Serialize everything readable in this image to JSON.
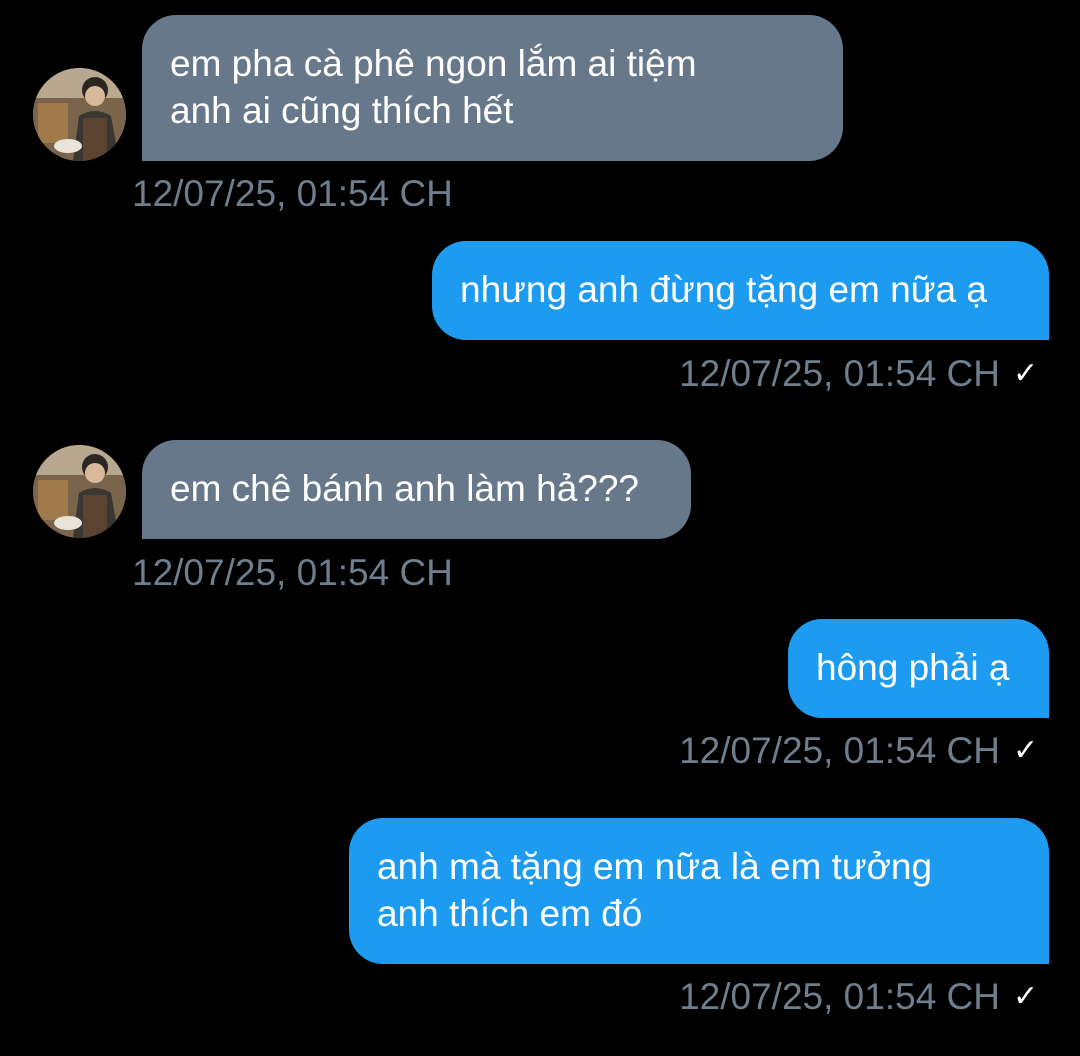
{
  "messages": [
    {
      "direction": "incoming",
      "text": "em pha cà phê ngon lắm ai tiệm\nanh ai cũng thích hết",
      "time": "12/07/25, 01:54 CH"
    },
    {
      "direction": "outgoing",
      "text": "nhưng anh đừng tặng em nữa ạ",
      "time": "12/07/25, 01:54 CH",
      "status_icon": "checkmark-icon"
    },
    {
      "direction": "incoming",
      "text": "em chê bánh anh làm hả???",
      "time": "12/07/25, 01:54 CH"
    },
    {
      "direction": "outgoing",
      "text": "hông phải ạ",
      "time": "12/07/25, 01:54 CH",
      "status_icon": "checkmark-icon"
    },
    {
      "direction": "outgoing",
      "text": "anh mà tặng em nữa là em tưởng\nanh thích em đó",
      "time": "12/07/25, 01:54 CH",
      "status_icon": "checkmark-icon"
    }
  ],
  "check_glyph": "✓",
  "colors": {
    "background": "#000000",
    "incoming_bubble": "#66788a",
    "outgoing_bubble": "#1d9bf0",
    "timestamp": "#6e7e8d"
  }
}
